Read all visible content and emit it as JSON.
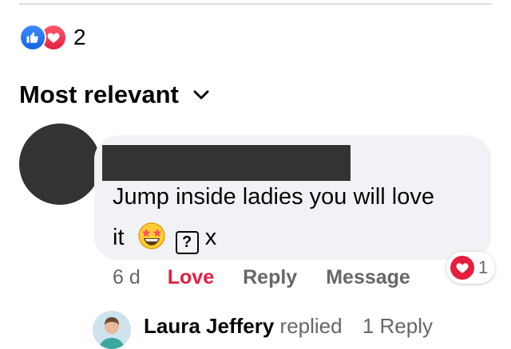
{
  "post_reactions": {
    "count": "2",
    "icons": [
      "like-icon",
      "love-icon"
    ],
    "colors": {
      "like": "#1877f2",
      "love": "#e41e3f"
    }
  },
  "sort": {
    "label": "Most relevant",
    "icon": "chevron-down-icon"
  },
  "comment": {
    "author_name_redacted": true,
    "text_line1": "Jump inside ladies you will love",
    "text_line2": "it",
    "emoji": "star-struck-emoji",
    "unknown_char": "?",
    "text_end": "x",
    "timestamp": "6 d",
    "reaction_badge": {
      "icon": "love-icon",
      "count": "1"
    },
    "actions": {
      "love": "Love",
      "reply": "Reply",
      "message": "Message"
    }
  },
  "reply_summary": {
    "name": "Laura Jeffery",
    "verb": "replied",
    "count": "1 Reply"
  }
}
